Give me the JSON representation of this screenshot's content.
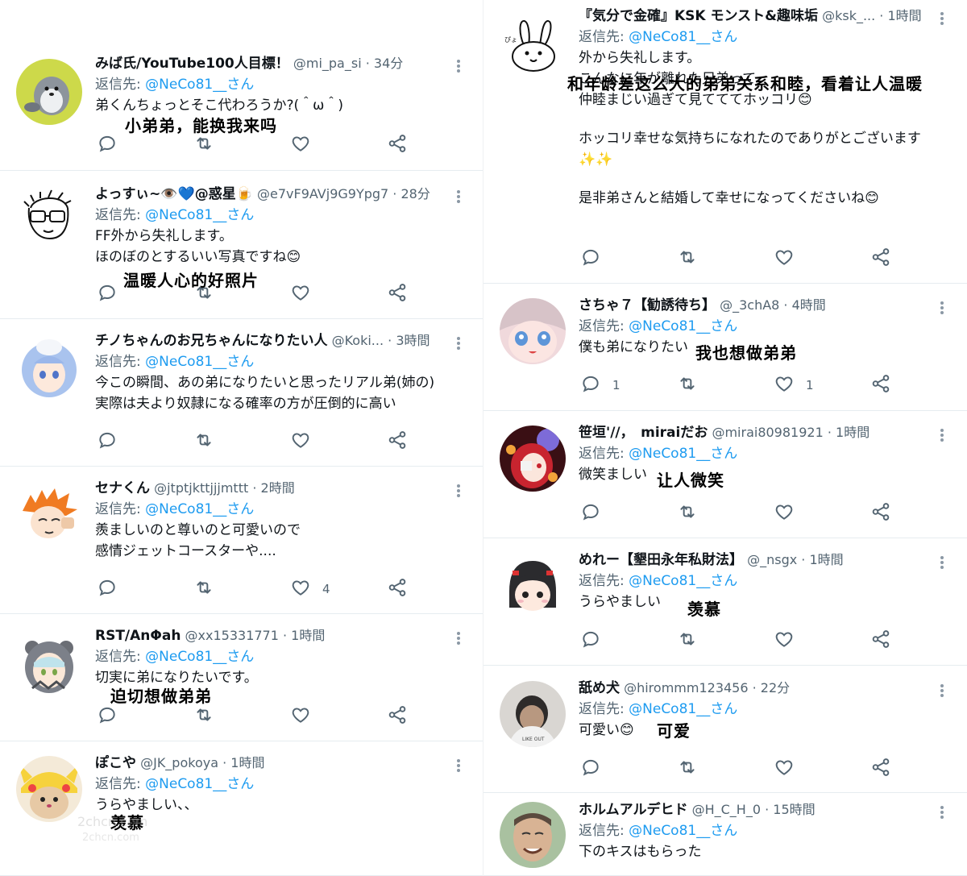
{
  "left_column": [
    {
      "name": "みば氏/YouTube100人目標！",
      "handle": "@mi_pa_si",
      "time": "34分",
      "reply_prefix": "返信先:",
      "reply_mention": "@NeCo81__さん",
      "body": "弟くんちょっとそこ代わろうか?(＾ω＾)",
      "overlay_translation": "小弟弟，能换我来吗",
      "reply_count": "",
      "like_count": "",
      "avatar": "penguin-avatar"
    },
    {
      "name": "よっすぃ~👁️💙@惑星🍺",
      "handle": "@e7vF9AVj9G9Ypg7",
      "time": "28分",
      "reply_prefix": "返信先:",
      "reply_mention": "@NeCo81__さん",
      "body": "FF外から失礼します。\nほのぼのとするいい写真ですね😊",
      "overlay_translation": "温暖人心的好照片",
      "reply_count": "",
      "like_count": "",
      "avatar": "glasses-sketch-avatar"
    },
    {
      "name": "チノちゃんのお兄ちゃんになりたい人",
      "handle": "@Koki...",
      "time": "3時間",
      "reply_prefix": "返信先:",
      "reply_mention": "@NeCo81__さん",
      "body": "今この瞬間、あの弟になりたいと思ったリアル弟(姉の)\n実際は夫より奴隷になる確率の方が圧倒的に高い",
      "overlay_translation": "",
      "reply_count": "",
      "like_count": "",
      "avatar": "anime-girl-blue-hair-avatar"
    },
    {
      "name": "セナくん",
      "handle": "@jtptjkttjjjmttt",
      "time": "2時間",
      "reply_prefix": "返信先:",
      "reply_mention": "@NeCo81__さん",
      "body": "羨ましいのと尊いのと可愛いので\n感情ジェットコースターや....",
      "overlay_translation": "",
      "reply_count": "",
      "like_count": "4",
      "avatar": "orange-hair-anime-avatar"
    },
    {
      "name": "RST/AnΦah",
      "handle": "@xx15331771",
      "time": "1時間",
      "reply_prefix": "返信先:",
      "reply_mention": "@NeCo81__さん",
      "body": "切実に弟になりたいです。",
      "overlay_translation": "迫切想做弟弟",
      "reply_count": "",
      "like_count": "",
      "avatar": "bear-hood-anime-avatar"
    },
    {
      "name": "ぽこや",
      "handle": "@JK_pokoya",
      "time": "1時間",
      "reply_prefix": "返信先:",
      "reply_mention": "@NeCo81__さん",
      "body": "うらやましい、、",
      "overlay_translation": "羡慕",
      "reply_count": "",
      "like_count": "",
      "avatar": "pikachu-hat-cat-avatar"
    }
  ],
  "right_column": [
    {
      "name": "『気分で金確』KSK モンスト&趣味垢",
      "handle": "@ksk_...",
      "time": "1時間",
      "reply_prefix": "返信先:",
      "reply_mention": "@NeCo81__さん",
      "body_lines": [
        "外から失礼します。",
        "こんなに年が離れた兄弟って",
        "仲睦まじい過ぎて見てててホッコリ😊",
        "",
        "ホッコリ幸せな気持ちになれたのでありがとございます✨✨",
        "",
        "是非弟さんと結婚して幸せになってくださいね😊"
      ],
      "overlay_translation": "和年龄差这么大的弟弟关系和睦，看着让人温暖",
      "reply_count": "",
      "like_count": "",
      "avatar": "rabbit-sketch-avatar"
    },
    {
      "name": "さちゃ７【勧誘待ち】",
      "handle": "@_3chA8",
      "time": "4時間",
      "reply_prefix": "返信先:",
      "reply_mention": "@NeCo81__さん",
      "body": "僕も弟になりたい",
      "overlay_translation": "我也想做弟弟",
      "reply_count": "1",
      "like_count": "1",
      "avatar": "anime-blue-eyes-avatar"
    },
    {
      "name": "笹垣'//，　miraiだお",
      "handle": "@mirai80981921",
      "time": "1時間",
      "reply_prefix": "返信先:",
      "reply_mention": "@NeCo81__さん",
      "body": "微笑ましい",
      "overlay_translation": "让人微笑",
      "reply_count": "",
      "like_count": "",
      "avatar": "red-anime-girl-avatar"
    },
    {
      "name": "めれー【墾田永年私財法】",
      "handle": "@_nsgx",
      "time": "1時間",
      "reply_prefix": "返信先:",
      "reply_mention": "@NeCo81__さん",
      "body": "うらやましい",
      "overlay_translation": "羡慕",
      "reply_count": "",
      "like_count": "",
      "avatar": "chibi-black-hair-avatar"
    },
    {
      "name": "舐め犬",
      "handle": "@hirommm123456",
      "time": "22分",
      "reply_prefix": "返信先:",
      "reply_mention": "@NeCo81__さん",
      "body": "可愛い😊",
      "overlay_translation": "可爱",
      "reply_count": "",
      "like_count": "",
      "avatar": "person-photo-avatar"
    },
    {
      "name": "ホルムアルデヒド",
      "handle": "@H_C_H_0",
      "time": "15時間",
      "reply_prefix": "返信先:",
      "reply_mention": "@NeCo81__さん",
      "body": "下のキスはもらった",
      "overlay_translation": "",
      "reply_count": "",
      "like_count": "",
      "avatar": "smiling-man-avatar"
    }
  ],
  "watermark": {
    "line1": "2chcn.com",
    "line2": "2chcn.com"
  },
  "colors": {
    "mention": "#1d9bf0",
    "secondary": "#536471",
    "divider": "#e6ecf0"
  }
}
